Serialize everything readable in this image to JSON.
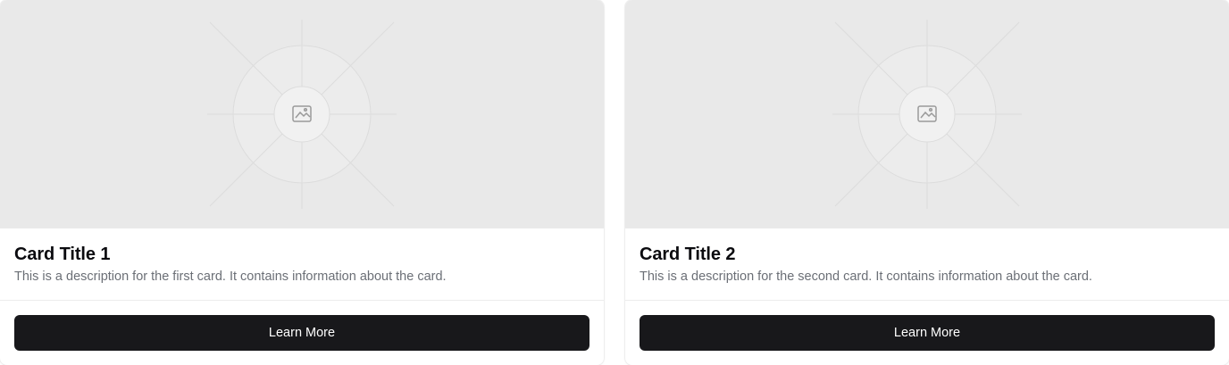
{
  "cards": [
    {
      "title": "Card Title 1",
      "description": "This is a description for the first card. It contains information about the card.",
      "button_label": "Learn More",
      "image_icon": "image-placeholder-icon"
    },
    {
      "title": "Card Title 2",
      "description": "This is a description for the second card. It contains information about the card.",
      "button_label": "Learn More",
      "image_icon": "image-placeholder-icon"
    }
  ],
  "colors": {
    "placeholder_bg": "#e9e9e9",
    "button_bg": "#18181b",
    "button_text": "#ffffff",
    "title_text": "#0b0b0f",
    "description_text": "#6b6f76"
  }
}
